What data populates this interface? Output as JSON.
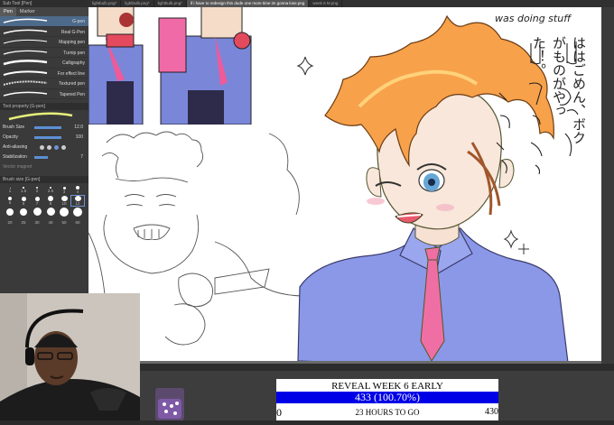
{
  "left_panel": {
    "sub_tool_title": "Sub Tool [Pen]",
    "tabs": [
      "Pen",
      "Marker"
    ],
    "brushes": [
      "G-pen",
      "Real G-Pen",
      "Mapping pen",
      "Turnip pen",
      "Calligraphy",
      "For effect line",
      "Textured pen",
      "Tapered Pen"
    ],
    "tool_property_title": "Tool property [G-pen]",
    "properties": [
      {
        "label": "Brush Size",
        "value": "12.0"
      },
      {
        "label": "Opacity",
        "value": "100"
      },
      {
        "label": "Anti-aliasing",
        "value": ""
      },
      {
        "label": "Stabilization",
        "value": "7"
      },
      {
        "label": "Vector magnet",
        "value": ""
      }
    ],
    "brush_size_title": "Brush size [G-pen]",
    "brush_sizes": [
      "1",
      "1.5",
      "2",
      "2.5",
      "3",
      "4",
      "5",
      "6",
      "7",
      "8",
      "10",
      "12",
      "15",
      "17",
      "20",
      "25",
      "30",
      "40",
      "50",
      "60",
      "70",
      "80",
      "100",
      "120"
    ]
  },
  "tabs": [
    "lightbulb.png*",
    "lightbulb.png*",
    "lightbulb.png*",
    "if i have to redesign this dude one more time im gonna lose.png",
    "week 6 M.png"
  ],
  "canvas": {
    "handwriting": {
      "english": "was doing stuff",
      "japanese": "ははごめん、ボクがものがやった！。"
    }
  },
  "goal": {
    "title": "REVEAL WEEK 6 EARLY",
    "progress": "433 (100.70%)",
    "progress_fraction": 1.0,
    "min": "0",
    "time_left": "23 HOURS TO GO",
    "max": "430",
    "bar_color": "#0000e6"
  }
}
